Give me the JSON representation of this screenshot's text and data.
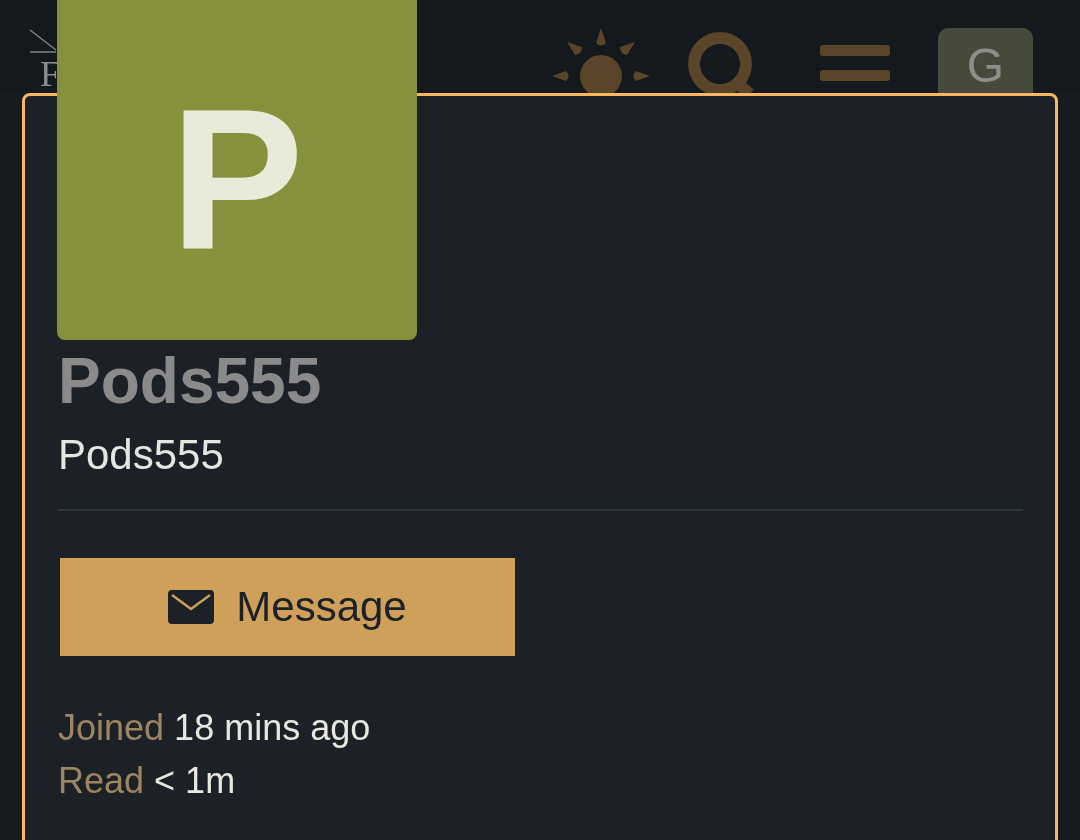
{
  "header": {
    "logo": "F",
    "user_initial": "G"
  },
  "profile": {
    "avatar_initial": "P",
    "display_name": "Pods555",
    "username": "Pods555",
    "message_button": "Message",
    "stats": [
      {
        "label": "Joined",
        "value": "18 mins ago"
      },
      {
        "label": "Read",
        "value": "< 1m"
      }
    ]
  }
}
